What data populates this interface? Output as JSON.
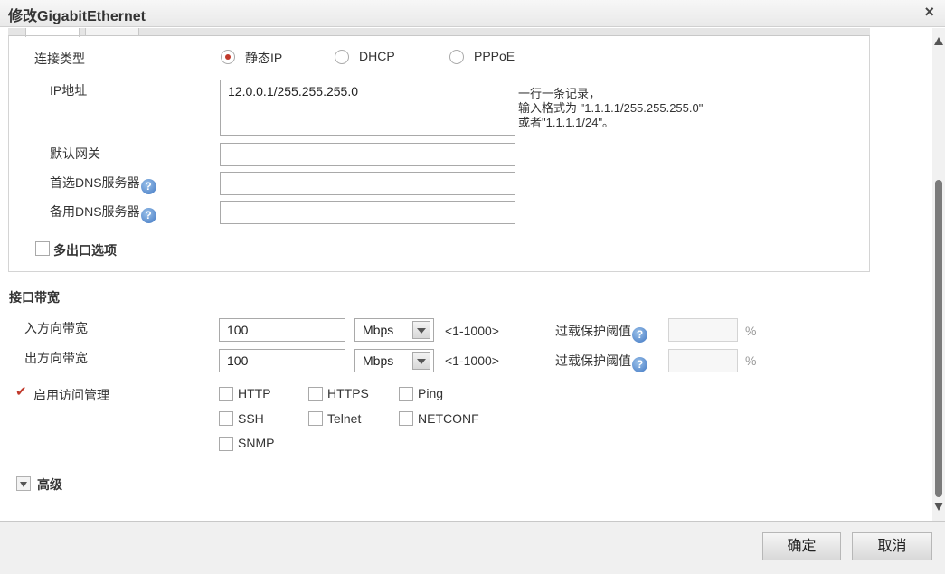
{
  "dialog": {
    "title": "修改GigabitEthernet",
    "close_label": "×"
  },
  "connection": {
    "label": "连接类型",
    "options": [
      "静态IP",
      "DHCP",
      "PPPoE"
    ],
    "selected": "静态IP"
  },
  "ip": {
    "label": "IP地址",
    "value": "12.0.0.1/255.255.255.0",
    "hint": [
      "一行一条记录，",
      "输入格式为 \"1.1.1.1/255.255.255.0\"",
      "或者\"1.1.1.1/24\"。"
    ]
  },
  "gateway": {
    "label": "默认网关",
    "value": ""
  },
  "dns_primary": {
    "label": "首选DNS服务器",
    "value": ""
  },
  "dns_secondary": {
    "label": "备用DNS服务器",
    "value": ""
  },
  "multi_exit": {
    "label": "多出口选项",
    "checked": false
  },
  "bandwidth": {
    "section_title": "接口带宽",
    "inbound": {
      "label": "入方向带宽",
      "value": "100",
      "unit": "Mbps",
      "range": "<1-1000>",
      "overload_label": "过载保护阈值",
      "overload_value": "",
      "percent": "%"
    },
    "outbound": {
      "label": "出方向带宽",
      "value": "100",
      "unit": "Mbps",
      "range": "<1-1000>",
      "overload_label": "过载保护阈值",
      "overload_value": "",
      "percent": "%"
    }
  },
  "access": {
    "label": "启用访问管理",
    "checked": true,
    "protocols": [
      "HTTP",
      "HTTPS",
      "Ping",
      "SSH",
      "Telnet",
      "NETCONF",
      "SNMP"
    ]
  },
  "advanced": {
    "label": "高级"
  },
  "footer": {
    "ok_label": "确定",
    "cancel_label": "取消"
  },
  "help_glyph": "?",
  "colors": {
    "accent_red": "#c0392b",
    "help_blue": "#3f76c2"
  }
}
